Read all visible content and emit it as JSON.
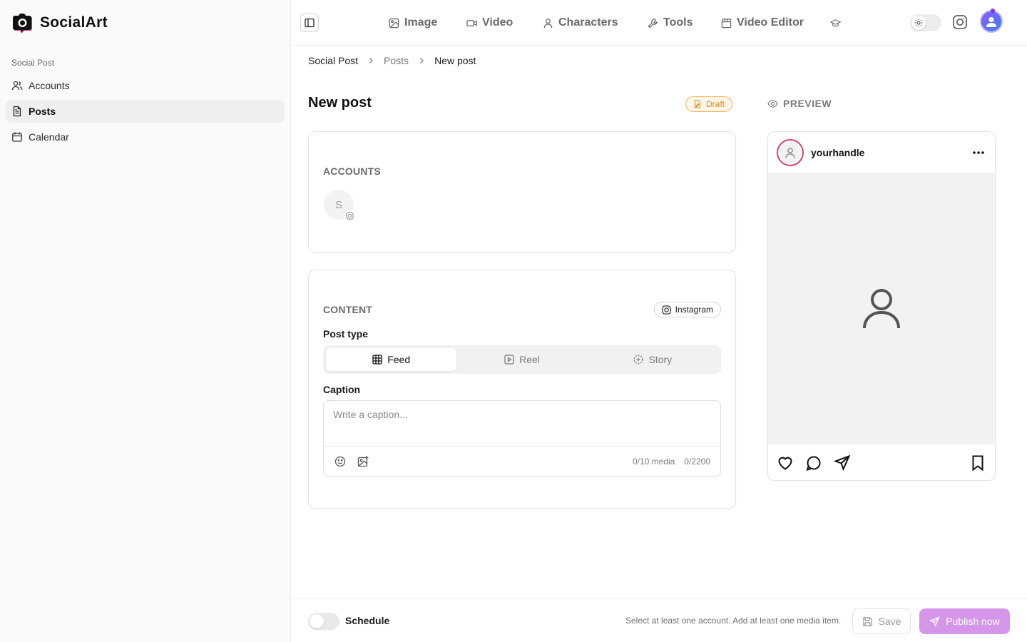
{
  "app": {
    "name": "SocialArt"
  },
  "sidebar": {
    "section": "Social Post",
    "items": [
      {
        "label": "Accounts",
        "icon": "users-icon"
      },
      {
        "label": "Posts",
        "icon": "document-icon",
        "active": true
      },
      {
        "label": "Calendar",
        "icon": "calendar-icon"
      }
    ]
  },
  "topnav": {
    "items": [
      {
        "label": "Image",
        "icon": "image-icon"
      },
      {
        "label": "Video",
        "icon": "video-icon"
      },
      {
        "label": "Characters",
        "icon": "user-icon"
      },
      {
        "label": "Tools",
        "icon": "wrench-icon"
      },
      {
        "label": "Video Editor",
        "icon": "clapperboard-icon"
      }
    ],
    "theme": "light"
  },
  "breadcrumb": {
    "items": [
      "Social Post",
      "Posts",
      "New post"
    ]
  },
  "page": {
    "title": "New post",
    "status": "Draft",
    "preview_label": "PREVIEW"
  },
  "accounts": {
    "label": "ACCOUNTS",
    "items": [
      {
        "initial": "S",
        "platform": "instagram"
      }
    ]
  },
  "content": {
    "label": "CONTENT",
    "platform_chip": "Instagram",
    "post_type_label": "Post type",
    "post_types": [
      {
        "label": "Feed",
        "icon": "grid-icon",
        "active": true
      },
      {
        "label": "Reel",
        "icon": "play-square-icon"
      },
      {
        "label": "Story",
        "icon": "story-icon"
      }
    ],
    "caption_label": "Caption",
    "caption_placeholder": "Write a caption...",
    "caption_value": "",
    "media_count": "0/10 media",
    "char_count": "0/2200"
  },
  "preview": {
    "handle": "yourhandle"
  },
  "footer": {
    "schedule_label": "Schedule",
    "schedule_on": false,
    "hint": "Select at least one account. Add at least one media item.",
    "save_label": "Save",
    "publish_label": "Publish now"
  },
  "colors": {
    "accent": "#d595e8",
    "draft_border": "#f0b35a",
    "draft_text": "#d98b1a",
    "avatar_ring": "#d6406d"
  }
}
